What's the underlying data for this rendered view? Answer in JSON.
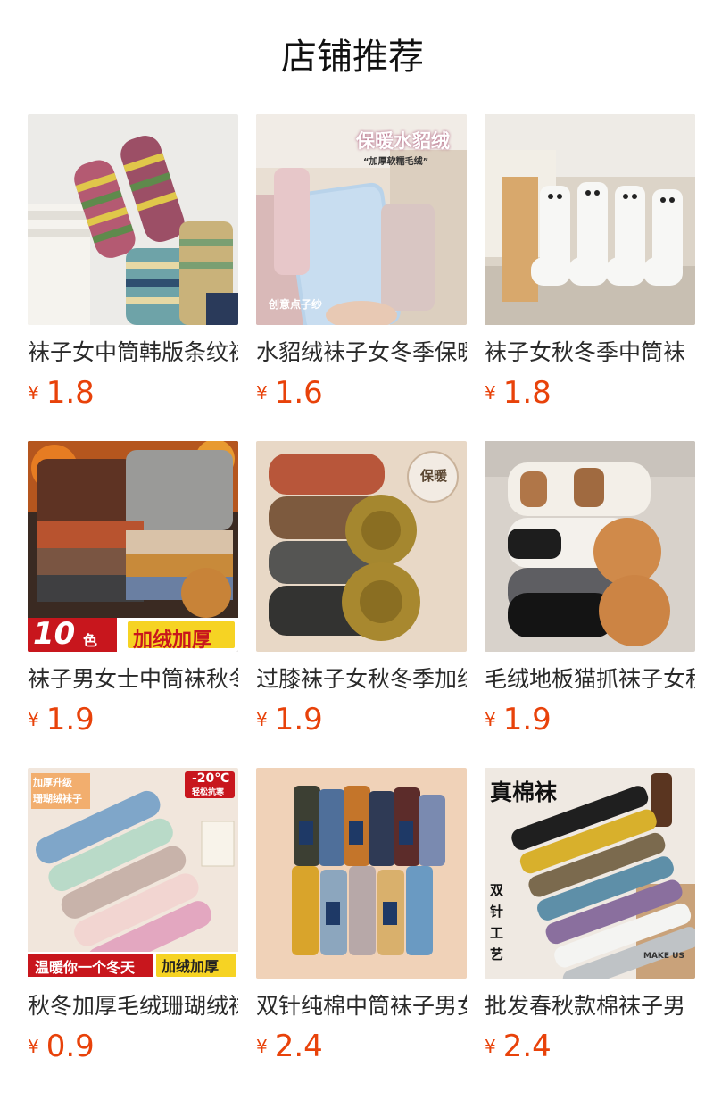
{
  "header": {
    "title": "店铺推荐"
  },
  "currency": "¥",
  "products": [
    {
      "name": "袜子女中筒韩版条纹袜",
      "price": "1.8",
      "badges": []
    },
    {
      "name": "水貂绒袜子女冬季保暖",
      "price": "1.6",
      "badges": [
        "保暖水貂绒",
        "“加厚软糯毛绒”",
        "创意点子纱"
      ]
    },
    {
      "name": "袜子女秋冬季中筒袜",
      "price": "1.8",
      "badges": []
    },
    {
      "name": "袜子男女士中筒袜秋冬",
      "price": "1.9",
      "badges": [
        "10",
        "色",
        "加绒加厚"
      ]
    },
    {
      "name": "过膝袜子女秋冬季加绒",
      "price": "1.9",
      "badges": [
        "保暖"
      ]
    },
    {
      "name": "毛绒地板猫抓袜子女秋",
      "price": "1.9",
      "badges": []
    },
    {
      "name": "秋冬加厚毛绒珊瑚绒袜",
      "price": "0.9",
      "badges": [
        "-20℃",
        "轻松抗寒",
        "温暖你一个冬天",
        "加绒加厚",
        "加厚升级",
        "珊瑚绒袜子"
      ]
    },
    {
      "name": "双针纯棉中筒袜子男女",
      "price": "2.4",
      "badges": []
    },
    {
      "name": "批发春秋款棉袜子男",
      "price": "2.4",
      "badges": [
        "真棉袜",
        "双",
        "针",
        "工",
        "艺",
        "MAKE US"
      ]
    }
  ]
}
